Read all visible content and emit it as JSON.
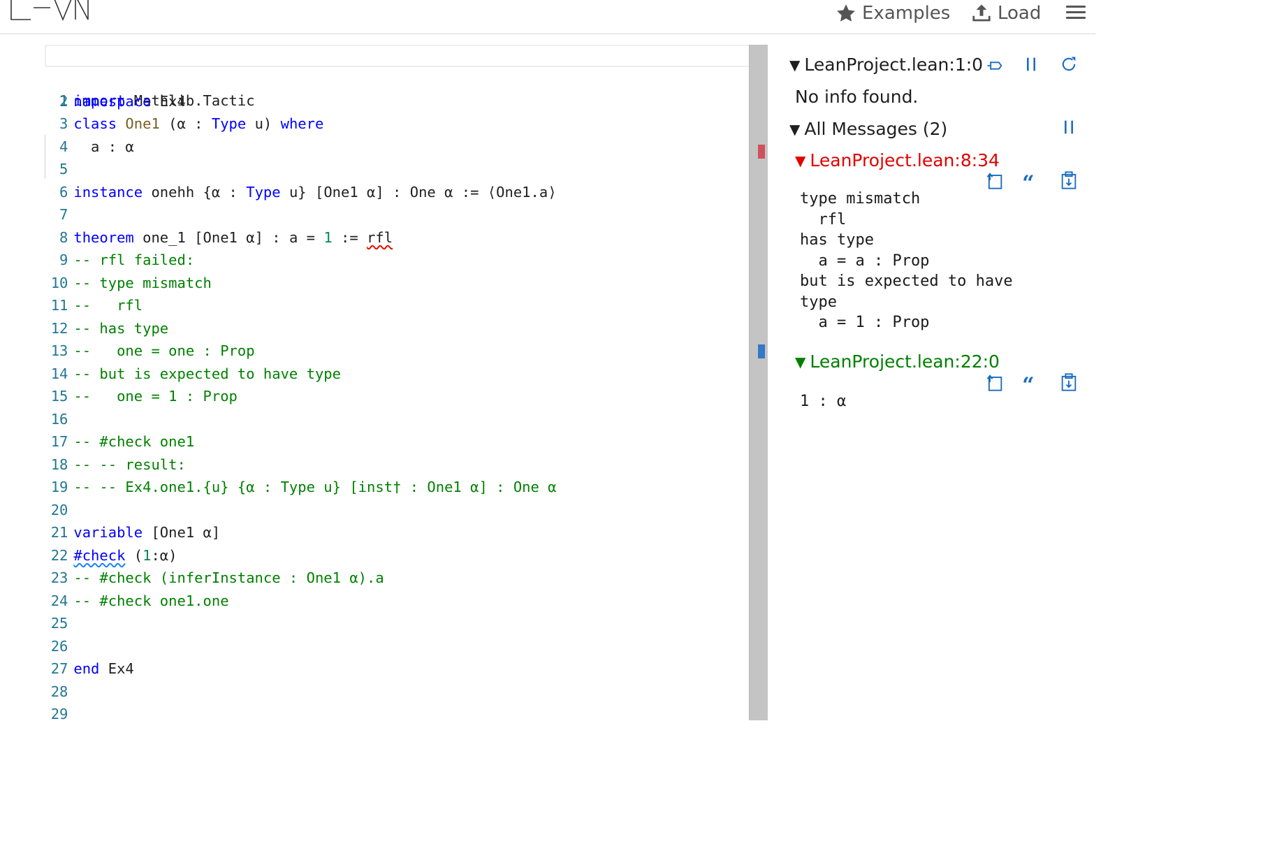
{
  "header": {
    "examples_label": "Examples",
    "load_label": "Load"
  },
  "editor": {
    "lines": [
      "1",
      "2",
      "3",
      "4",
      "5",
      "6",
      "7",
      "8",
      "9",
      "10",
      "11",
      "12",
      "13",
      "14",
      "15",
      "16",
      "17",
      "18",
      "19",
      "20",
      "21",
      "22",
      "23",
      "24",
      "25",
      "26",
      "27",
      "28",
      "29"
    ],
    "code": {
      "l1_kw": "import",
      "l1_rest": " Mathlib.Tactic",
      "l2_kw": "namespace",
      "l2_rest": " Ex4",
      "l3_kw": "class",
      "l3_cls": " One1",
      "l3_a": " (α : ",
      "l3_ty": "Type",
      "l3_b": " u) ",
      "l3_kw2": "where",
      "l4": "  a : α",
      "l6_kw": "instance",
      "l6_a": " onehh {α : ",
      "l6_ty": "Type",
      "l6_b": " u} [One1 α] : One α := ⟨One1.a⟩",
      "l8_kw": "theorem",
      "l8_a": " one_1 [One1 α] : a = ",
      "l8_num": "1",
      "l8_b": " := ",
      "l8_rfl": "rfl",
      "l9": "-- rfl failed:",
      "l10": "-- type mismatch",
      "l11": "--   rfl",
      "l12": "-- has type",
      "l13": "--   one = one : Prop",
      "l14": "-- but is expected to have type",
      "l15": "--   one = 1 : Prop",
      "l17": "-- #check one1",
      "l18": "-- -- result:",
      "l19": "-- -- Ex4.one1.{u} {α : Type u} [inst† : One1 α] : One α",
      "l21_kw": "variable",
      "l21_rest": " [One1 α]",
      "l22_kw": "#check",
      "l22_a": " (",
      "l22_num": "1",
      "l22_b": ":α)",
      "l23": "-- #check (inferInstance : One1 α).a",
      "l24": "-- #check one1.one",
      "l27_kw": "end",
      "l27_rest": " Ex4"
    }
  },
  "infoview": {
    "goal_header": "LeanProject.lean:1:0",
    "no_info": "No info found.",
    "all_messages": "All Messages (2)",
    "msg1": {
      "location": "LeanProject.lean:8:34",
      "body": "type mismatch\n  rfl\nhas type\n  a = a : Prop\nbut is expected to have\ntype\n  a = 1 : Prop"
    },
    "msg2": {
      "location": "LeanProject.lean:22:0",
      "body": "1 : α"
    },
    "colors": {
      "error": "#e10000",
      "info": "#007f00",
      "icon": "#1a6bbf"
    }
  }
}
